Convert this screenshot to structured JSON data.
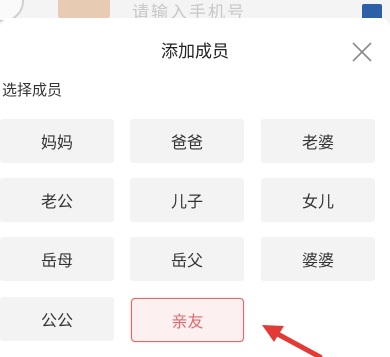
{
  "background": {
    "search_hint": "请输入手机号"
  },
  "sheet": {
    "title": "添加成员",
    "section_label": "选择成员",
    "close_icon": "close-icon"
  },
  "members": [
    {
      "label": "妈妈",
      "selected": false
    },
    {
      "label": "爸爸",
      "selected": false
    },
    {
      "label": "老婆",
      "selected": false
    },
    {
      "label": "老公",
      "selected": false
    },
    {
      "label": "儿子",
      "selected": false
    },
    {
      "label": "女儿",
      "selected": false
    },
    {
      "label": "岳母",
      "selected": false
    },
    {
      "label": "岳父",
      "selected": false
    },
    {
      "label": "婆婆",
      "selected": false
    },
    {
      "label": "公公",
      "selected": false
    },
    {
      "label": "亲友",
      "selected": true
    }
  ],
  "colors": {
    "accent": "#e0686a",
    "annotation_arrow": "#e23b36",
    "option_bg": "#f3f3f3"
  }
}
